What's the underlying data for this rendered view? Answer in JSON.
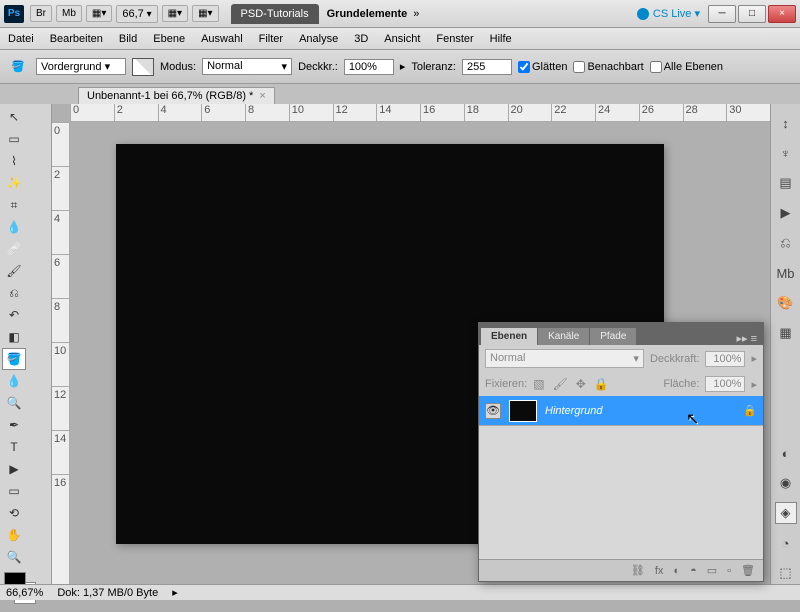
{
  "titlebar": {
    "app": "Ps",
    "badges": [
      "Br",
      "Mb"
    ],
    "zoom": "66,7",
    "tab": "PSD-Tutorials",
    "doc_label": "Grundelemente",
    "cslive": "CS Live ▾",
    "min": "─",
    "max": "□",
    "close": "×"
  },
  "menu": {
    "items": [
      "Datei",
      "Bearbeiten",
      "Bild",
      "Ebene",
      "Auswahl",
      "Filter",
      "Analyse",
      "3D",
      "Ansicht",
      "Fenster",
      "Hilfe"
    ]
  },
  "options": {
    "fg_label": "Vordergrund ▾",
    "modus_label": "Modus:",
    "modus_value": "Normal",
    "deckkr_label": "Deckkr.:",
    "deckkr_value": "100%",
    "toleranz_label": "Toleranz:",
    "toleranz_value": "255",
    "glatten": "Glätten",
    "benachbart": "Benachbart",
    "alle_ebenen": "Alle Ebenen"
  },
  "doctab": {
    "label": "Unbenannt-1 bei 66,7% (RGB/8) *",
    "close": "×"
  },
  "ruler_h": [
    "0",
    "2",
    "4",
    "6",
    "8",
    "10",
    "12",
    "14",
    "16",
    "18",
    "20",
    "22",
    "24",
    "26",
    "28",
    "30"
  ],
  "ruler_v": [
    "0",
    "2",
    "4",
    "6",
    "8",
    "10",
    "12",
    "14",
    "16"
  ],
  "status": {
    "zoom": "66,67%",
    "info": "Dok: 1,37 MB/0 Byte"
  },
  "layers_panel": {
    "tabs": [
      "Ebenen",
      "Kanäle",
      "Pfade"
    ],
    "close": "▸▸ ≡",
    "blend_mode": "Normal",
    "deckkraft_label": "Deckkraft:",
    "deckkraft_value": "100%",
    "fixieren_label": "Fixieren:",
    "flaeche_label": "Fläche:",
    "flaeche_value": "100%",
    "layer": {
      "name": "Hintergrund",
      "eye": "👁",
      "lock": "🔒"
    },
    "footer_icons": [
      "⛓",
      "fx",
      "◐",
      "◓",
      "▭",
      "▫",
      "🗑"
    ]
  }
}
